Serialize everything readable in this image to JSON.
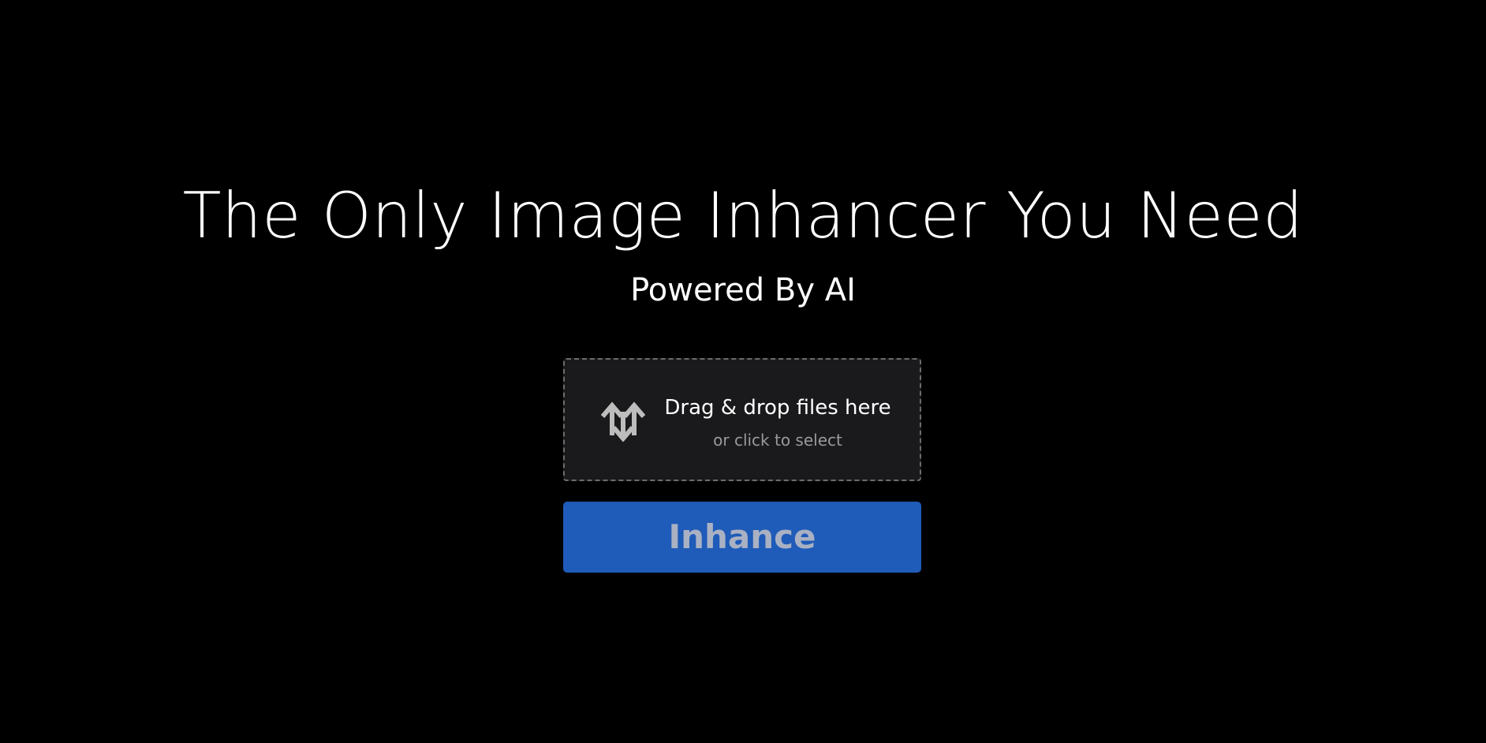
{
  "hero": {
    "title": "The Only Image Inhancer You Need",
    "subtitle": "Powered By AI"
  },
  "dropzone": {
    "title": "Drag & drop files here",
    "hint": "or click to select",
    "icon": "upload-arrows-icon"
  },
  "action": {
    "button_label": "Inhance"
  },
  "colors": {
    "background": "#000000",
    "dropzone_background": "#1a1a1c",
    "dropzone_border": "#6c6c6c",
    "button_background": "#1f5bb8",
    "button_text": "#a9b1c3"
  }
}
